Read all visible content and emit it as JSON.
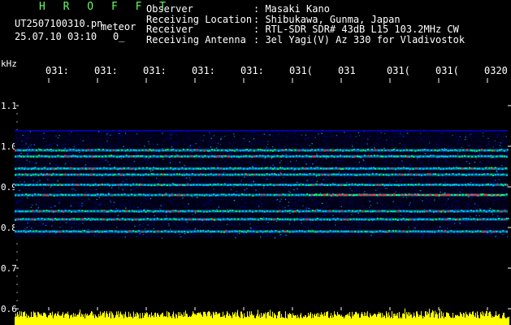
{
  "header": {
    "brand": "H R O F F T",
    "filename": "UT2507100310.pn",
    "filename_tag": "meteor",
    "date_line": "25.07.10 03:10",
    "date_extra": "0_"
  },
  "info": [
    {
      "label": "Observer",
      "value": ": Masaki Kano"
    },
    {
      "label": "Receiving Location",
      "value": ": Shibukawa, Gunma, Japan"
    },
    {
      "label": "Receiver",
      "value": ": RTL-SDR SDR# 43dB L15 103.2MHz CW"
    },
    {
      "label": "Receiving Antenna",
      "value": ": 3el Yagi(V) Az 330 for Vladivostok"
    }
  ],
  "plot": {
    "unit_label": "kHz",
    "time_labels": [
      "031:",
      "031:",
      "031:",
      "031:",
      "031:",
      "031(",
      "031",
      "031(",
      "031(",
      "0320"
    ],
    "freq_labels": [
      "1.1",
      "1.0",
      "0.9",
      "0.8",
      "0.7",
      "0.6"
    ],
    "colors": {
      "background": "#000000",
      "noise": "#0000cc",
      "signal_low": "#00c8ff",
      "signal_mid": "#00ff60",
      "signal_high": "#ff3030",
      "amplitude": "#ffff00",
      "tick": "#ffffff",
      "brand": "#5fff5f"
    },
    "bands_khz": [
      0.99,
      0.975,
      0.945,
      0.93,
      0.905,
      0.88,
      0.84,
      0.82,
      0.79
    ],
    "band_top_khz": 1.04,
    "band_bottom_khz": 0.775
  }
}
